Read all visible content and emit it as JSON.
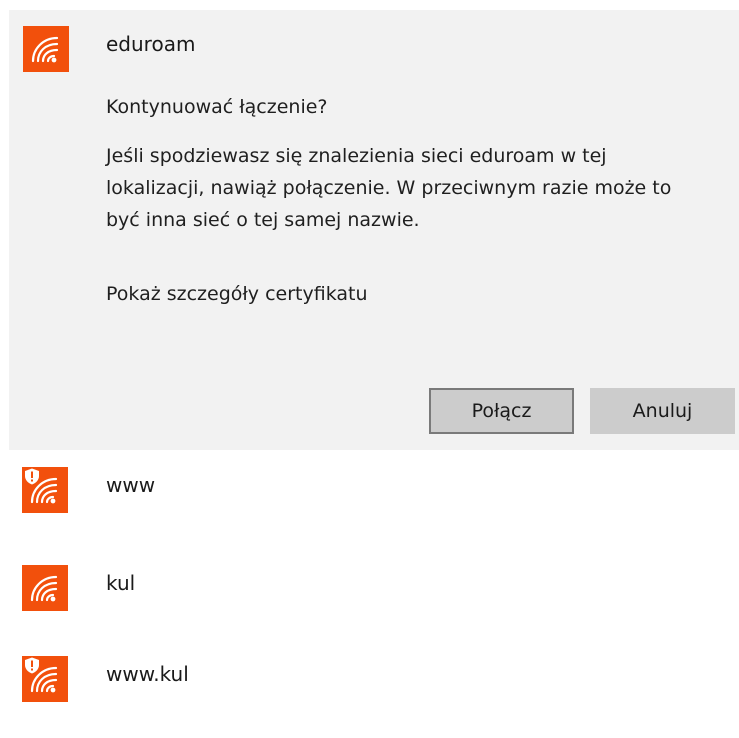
{
  "accent_color": "#f2500c",
  "selected_network": {
    "name": "eduroam",
    "icon": "wifi-icon",
    "question": "Kontynuować łączenie?",
    "description": "Jeśli spodziewasz się znalezienia sieci eduroam w tej lokalizacji, nawiąż połączenie. W przeciwnym razie może to być inna sieć o tej samej nazwie.",
    "certificate_link": "Pokaż szczegóły certyfikatu",
    "connect_label": "Połącz",
    "cancel_label": "Anuluj"
  },
  "networks": [
    {
      "name": "www",
      "icon": "wifi-icon",
      "secured_warning": true
    },
    {
      "name": "kul",
      "icon": "wifi-icon",
      "secured_warning": false
    },
    {
      "name": "www.kul",
      "icon": "wifi-icon",
      "secured_warning": true
    }
  ]
}
